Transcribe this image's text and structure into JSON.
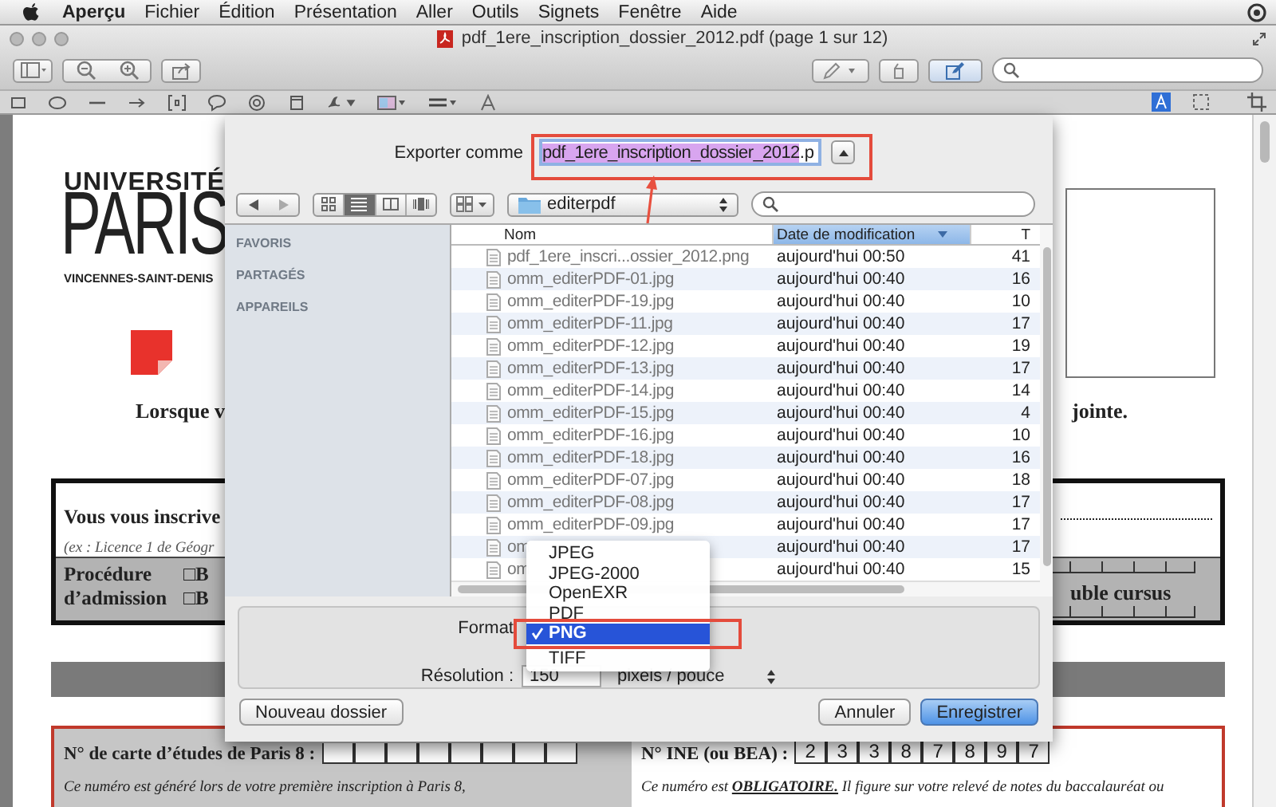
{
  "menu_bar": {
    "app": "Aperçu",
    "items": [
      "Fichier",
      "Édition",
      "Présentation",
      "Aller",
      "Outils",
      "Signets",
      "Fenêtre",
      "Aide"
    ]
  },
  "window": {
    "title": "pdf_1ere_inscription_dossier_2012.pdf (page 1 sur 12)"
  },
  "document": {
    "logo": {
      "top": "UNIVERSITÉ",
      "main": "PARIS",
      "sub": "VINCENNES-SAINT-DENIS"
    },
    "intro_left": "Lorsque v",
    "intro_right": "jointe.",
    "enrolment": {
      "line": "Vous vous inscrive",
      "example": "(ex : Licence 1 de Géogr",
      "procedure_label": "Procédure d’admission",
      "options": [
        "□B",
        "□B"
      ],
      "right_text": "uble cursus"
    },
    "student_card": {
      "label": "N° de carte d’études de Paris 8 :",
      "note": "Ce numéro est généré lors de votre première inscription à Paris 8,"
    },
    "ine": {
      "label": "N° INE (ou BEA) :",
      "digits": [
        "2",
        "3",
        "3",
        "8",
        "7",
        "8",
        "9",
        "7"
      ],
      "note": "Ce numéro est **OBLIGATOIRE.** Il figure sur votre relevé de notes du baccalauréat ou"
    }
  },
  "export_sheet": {
    "export_label": "Exporter comme",
    "filename": {
      "selected_part": "pdf_1ere_inscription_dossier_2012",
      "rest": ".p"
    },
    "view_modes": [
      {
        "selected": false
      },
      {
        "selected": true
      },
      {
        "selected": false
      },
      {
        "selected": false
      }
    ],
    "location": "editerpdf",
    "sidebar": [
      "FAVORIS",
      "PARTAGÉS",
      "APPAREILS"
    ],
    "file_list": {
      "columns": [
        {
          "label": "Nom",
          "sorted": false
        },
        {
          "label": "Date de modification",
          "sorted": true
        },
        {
          "label": "T",
          "sorted": false
        }
      ],
      "rows": [
        {
          "name": "pdf_1ere_inscri...ossier_2012.png",
          "date": "aujourd'hui 00:50",
          "size": "41"
        },
        {
          "name": "omm_editerPDF-01.jpg",
          "date": "aujourd'hui 00:40",
          "size": "16"
        },
        {
          "name": "omm_editerPDF-19.jpg",
          "date": "aujourd'hui 00:40",
          "size": "10"
        },
        {
          "name": "omm_editerPDF-11.jpg",
          "date": "aujourd'hui 00:40",
          "size": "17"
        },
        {
          "name": "omm_editerPDF-12.jpg",
          "date": "aujourd'hui 00:40",
          "size": "19"
        },
        {
          "name": "omm_editerPDF-13.jpg",
          "date": "aujourd'hui 00:40",
          "size": "17"
        },
        {
          "name": "omm_editerPDF-14.jpg",
          "date": "aujourd'hui 00:40",
          "size": "14"
        },
        {
          "name": "omm_editerPDF-15.jpg",
          "date": "aujourd'hui 00:40",
          "size": "4"
        },
        {
          "name": "omm_editerPDF-16.jpg",
          "date": "aujourd'hui 00:40",
          "size": "10"
        },
        {
          "name": "omm_editerPDF-18.jpg",
          "date": "aujourd'hui 00:40",
          "size": "16"
        },
        {
          "name": "omm_editerPDF-07.jpg",
          "date": "aujourd'hui 00:40",
          "size": "18"
        },
        {
          "name": "omm_editerPDF-08.jpg",
          "date": "aujourd'hui 00:40",
          "size": "17"
        },
        {
          "name": "omm_editerPDF-09.jpg",
          "date": "aujourd'hui 00:40",
          "size": "17"
        },
        {
          "name": "om",
          "date": "aujourd'hui 00:40",
          "size": "17"
        },
        {
          "name": "om",
          "date": "aujourd'hui 00:40",
          "size": "15"
        }
      ]
    },
    "format": {
      "label": "Format",
      "options": [
        {
          "label": "JPEG",
          "selected": false
        },
        {
          "label": "JPEG-2000",
          "selected": false
        },
        {
          "label": "OpenEXR",
          "selected": false
        },
        {
          "label": "PDF",
          "selected": false
        },
        {
          "label": "PNG",
          "selected": true
        },
        {
          "label": "TIFF",
          "selected": false
        }
      ]
    },
    "resolution": {
      "label": "Résolution :",
      "value": "150",
      "unit": "pixels / pouce"
    },
    "buttons": [
      {
        "label": "Nouveau dossier",
        "kind": "secondary"
      },
      {
        "label": "Annuler",
        "kind": "secondary"
      },
      {
        "label": "Enregistrer",
        "kind": "default"
      }
    ]
  }
}
